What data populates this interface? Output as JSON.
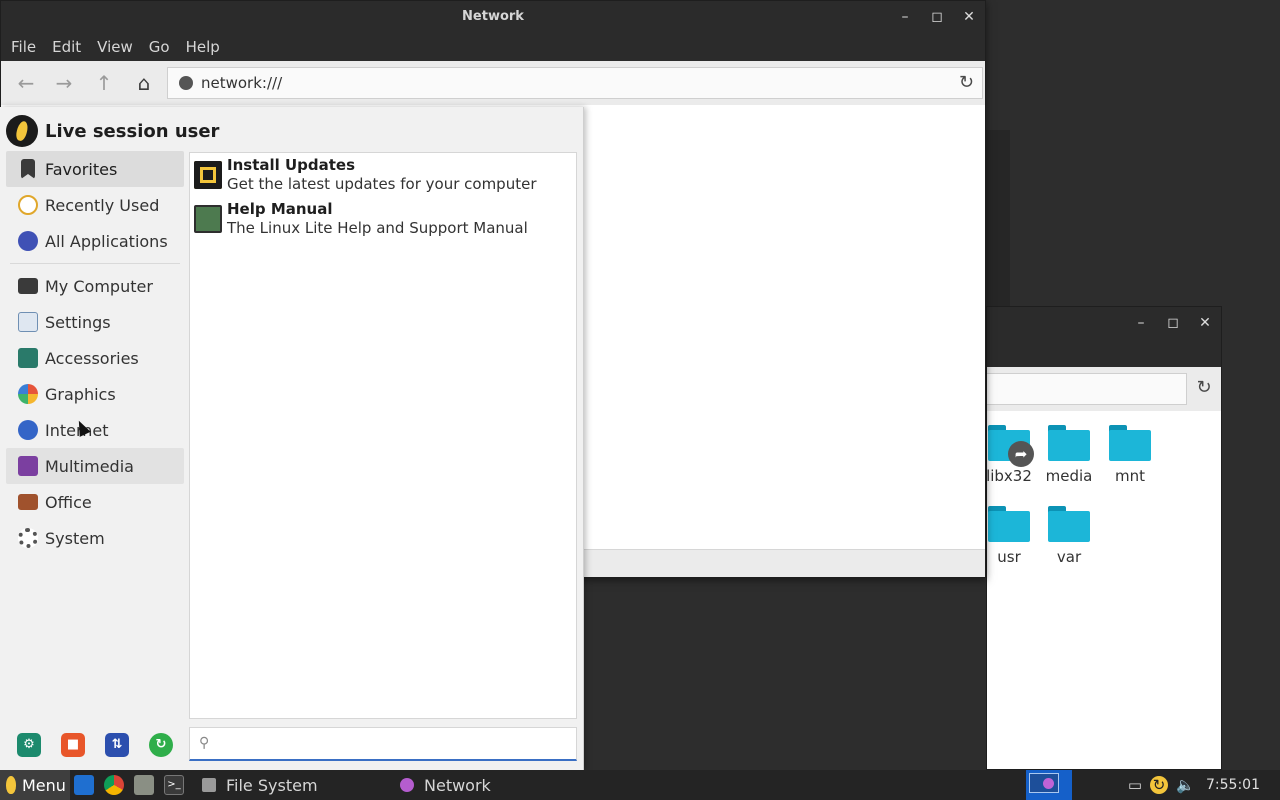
{
  "network_window": {
    "title": "Network",
    "menu": [
      "File",
      "Edit",
      "View",
      "Go",
      "Help"
    ],
    "address": "network:///"
  },
  "filesystem_window": {
    "items": [
      {
        "label": "libx32",
        "symlink": true
      },
      {
        "label": "media",
        "symlink": false
      },
      {
        "label": "mnt",
        "symlink": false
      },
      {
        "label": "usr",
        "symlink": false
      },
      {
        "label": "var",
        "symlink": false
      }
    ]
  },
  "app_menu": {
    "user": "Live session user",
    "categories": [
      {
        "label": "Favorites",
        "icon": "bookmark-icon",
        "color": "#3a3a3a"
      },
      {
        "label": "Recently Used",
        "icon": "clock-icon",
        "color": "#e0a72b"
      },
      {
        "label": "All Applications",
        "icon": "apps-icon",
        "color": "#3f51b5"
      },
      {
        "label": "My Computer",
        "icon": "monitor-icon",
        "color": "#3a3a3a"
      },
      {
        "label": "Settings",
        "icon": "settings-sliders-icon",
        "color": "#6f8fb3"
      },
      {
        "label": "Accessories",
        "icon": "accessories-icon",
        "color": "#2a7a6a"
      },
      {
        "label": "Graphics",
        "icon": "graphics-palette-icon",
        "color": "#e6543a"
      },
      {
        "label": "Internet",
        "icon": "globe-icon",
        "color": "#3465c7"
      },
      {
        "label": "Multimedia",
        "icon": "multimedia-icon",
        "color": "#7b3fa0"
      },
      {
        "label": "Office",
        "icon": "briefcase-icon",
        "color": "#a0522d"
      },
      {
        "label": "System",
        "icon": "gear-icon",
        "color": "#555555"
      }
    ],
    "apps": [
      {
        "title": "Install Updates",
        "desc": "Get the latest updates for your computer",
        "icon": "updates-icon"
      },
      {
        "title": "Help Manual",
        "desc": "The Linux Lite Help and Support Manual",
        "icon": "help-manual-icon"
      }
    ],
    "search": {
      "placeholder": "",
      "value": ""
    },
    "actions": [
      {
        "name": "settings-action-icon",
        "color": "#1c8a6d"
      },
      {
        "name": "lock-screen-icon",
        "color": "#e8562a"
      },
      {
        "name": "switch-user-icon",
        "color": "#2c4fae"
      },
      {
        "name": "log-out-icon",
        "color": "#2fae4a"
      }
    ]
  },
  "taskbar": {
    "menu_label": "Menu",
    "tasks": [
      {
        "label": "File System",
        "icon": "file-manager-icon"
      },
      {
        "label": "Network",
        "icon": "network-icon"
      }
    ],
    "clock": "7:55:01 pm"
  }
}
